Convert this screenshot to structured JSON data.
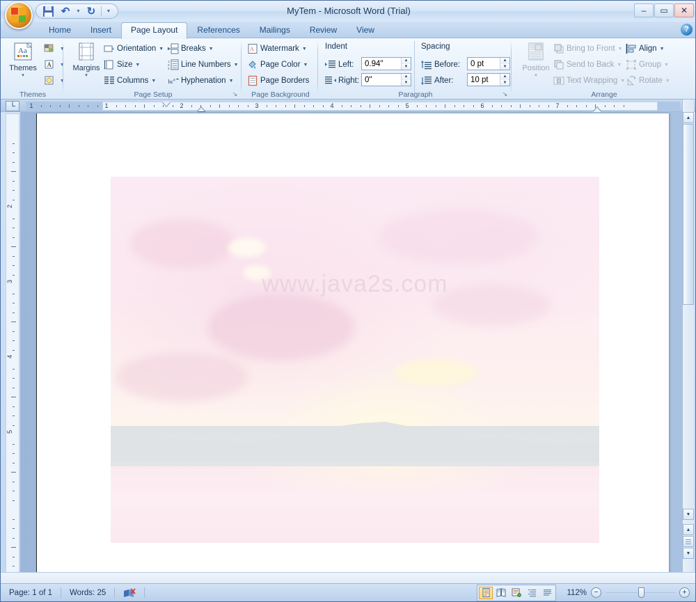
{
  "window": {
    "title": "MyTem - Microsoft Word (Trial)",
    "minimize_label": "–",
    "maximize_label": "▭",
    "close_label": "✕"
  },
  "quick_access": {
    "office_button_name": "Office Button",
    "buttons": [
      {
        "name": "save-button",
        "icon": "save-icon",
        "label": "Save"
      },
      {
        "name": "undo-button",
        "icon": "undo-icon",
        "label": "↶"
      },
      {
        "name": "redo-button",
        "icon": "redo-icon",
        "label": "↻"
      },
      {
        "name": "customize-qat-button",
        "icon": "chevron-down-icon",
        "label": "▾"
      }
    ]
  },
  "tabs": [
    {
      "label": "Home",
      "active": false
    },
    {
      "label": "Insert",
      "active": false
    },
    {
      "label": "Page Layout",
      "active": true
    },
    {
      "label": "References",
      "active": false
    },
    {
      "label": "Mailings",
      "active": false
    },
    {
      "label": "Review",
      "active": false
    },
    {
      "label": "View",
      "active": false
    }
  ],
  "help": {
    "label": "?"
  },
  "ribbon": {
    "groups": [
      {
        "name": "themes",
        "label": "Themes",
        "big_button": {
          "label": "Themes",
          "caret": "▾"
        },
        "small_buttons": [
          {
            "label": "Theme Colors",
            "icon": "theme-colors-icon"
          },
          {
            "label": "Theme Fonts",
            "icon": "theme-fonts-icon"
          },
          {
            "label": "Theme Effects",
            "icon": "theme-effects-icon"
          }
        ]
      },
      {
        "name": "page-setup",
        "label": "Page Setup",
        "big_button": {
          "label": "Margins",
          "caret": "▾"
        },
        "items": [
          {
            "label": "Orientation",
            "caret": "▾",
            "icon": "orientation-icon"
          },
          {
            "label": "Size",
            "caret": "▾",
            "icon": "size-icon"
          },
          {
            "label": "Columns",
            "caret": "▾",
            "icon": "columns-icon"
          },
          {
            "label": "Breaks",
            "caret": "▾",
            "icon": "breaks-icon"
          },
          {
            "label": "Line Numbers",
            "caret": "▾",
            "icon": "line-numbers-icon"
          },
          {
            "label": "Hyphenation",
            "caret": "▾",
            "icon": "hyphenation-icon"
          }
        ],
        "dialog_launcher": "↘"
      },
      {
        "name": "page-background",
        "label": "Page Background",
        "items": [
          {
            "label": "Watermark",
            "caret": "▾",
            "icon": "watermark-icon"
          },
          {
            "label": "Page Color",
            "caret": "▾",
            "icon": "page-color-icon"
          },
          {
            "label": "Page Borders",
            "caret": "",
            "icon": "page-borders-icon"
          }
        ]
      },
      {
        "name": "paragraph",
        "label": "Paragraph",
        "indent": {
          "heading": "Indent",
          "left_label": "Left:",
          "left_value": "0.94\"",
          "right_label": "Right:",
          "right_value": "0\""
        },
        "spacing": {
          "heading": "Spacing",
          "before_label": "Before:",
          "before_value": "0 pt",
          "after_label": "After:",
          "after_value": "10 pt"
        },
        "dialog_launcher": "↘"
      },
      {
        "name": "arrange",
        "label": "Arrange",
        "big_button": {
          "label": "Position",
          "caret": "▾",
          "disabled": true
        },
        "items": [
          {
            "label": "Bring to Front",
            "caret": "▾",
            "icon": "bring-to-front-icon",
            "disabled": true
          },
          {
            "label": "Send to Back",
            "caret": "▾",
            "icon": "send-to-back-icon",
            "disabled": true
          },
          {
            "label": "Text Wrapping",
            "caret": "▾",
            "icon": "text-wrapping-icon",
            "disabled": true
          },
          {
            "label": "Align",
            "caret": "▾",
            "icon": "align-icon",
            "disabled": false
          },
          {
            "label": "Group",
            "caret": "▾",
            "icon": "group-icon",
            "disabled": true
          },
          {
            "label": "Rotate",
            "caret": "▾",
            "icon": "rotate-icon",
            "disabled": true
          }
        ]
      }
    ]
  },
  "ruler": {
    "tab_selector_glyph": "└",
    "horizontal_numbers": [
      "1",
      "1",
      "2",
      "3",
      "4",
      "5",
      "6",
      "7"
    ],
    "vertical_numbers": [
      "2",
      "3",
      "4",
      "5"
    ],
    "first_line_indent_marker": "first-line-indent-marker",
    "left_indent_marker": "left-indent-marker",
    "right_indent_marker": "right-indent-marker"
  },
  "document": {
    "image": {
      "name": "sunset-landscape-picture",
      "watermark_text": "www.java2s.com"
    }
  },
  "status_bar": {
    "page": "Page: 1 of 1",
    "words": "Words: 25",
    "proofing_icon": "spell-check-icon",
    "view_buttons": [
      {
        "name": "print-layout-view-button",
        "label": "Print Layout",
        "selected": true
      },
      {
        "name": "full-screen-reading-view-button",
        "label": "Full Screen Reading",
        "selected": false
      },
      {
        "name": "web-layout-view-button",
        "label": "Web Layout",
        "selected": false
      },
      {
        "name": "outline-view-button",
        "label": "Outline",
        "selected": false
      },
      {
        "name": "draft-view-button",
        "label": "Draft",
        "selected": false
      }
    ],
    "zoom": "112%",
    "zoom_out_label": "−",
    "zoom_in_label": "+"
  },
  "colors": {
    "accent": "#1c4f87",
    "ribbon_bg": "#e8f1fb",
    "titlebar": "#d6e6f7",
    "selection": "#ffd878"
  }
}
